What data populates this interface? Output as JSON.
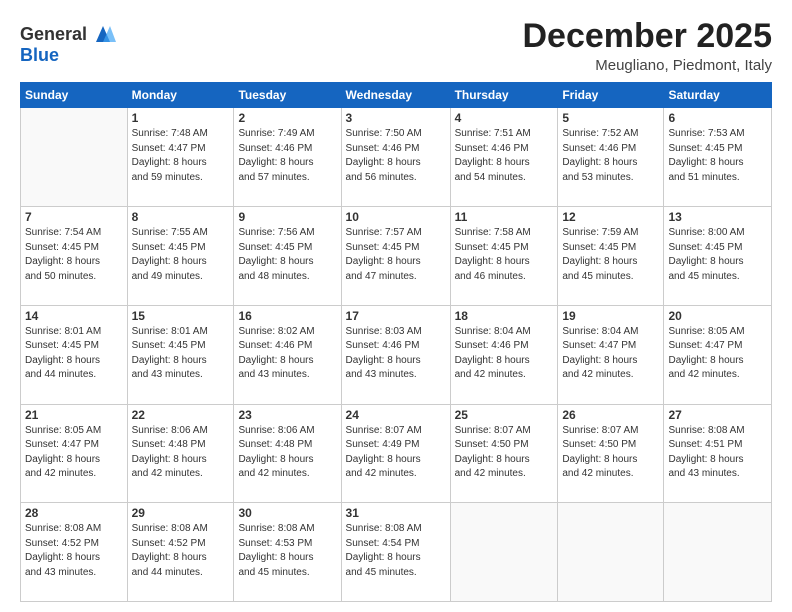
{
  "header": {
    "logo_line1": "General",
    "logo_line2": "Blue",
    "month": "December 2025",
    "location": "Meugliano, Piedmont, Italy"
  },
  "weekdays": [
    "Sunday",
    "Monday",
    "Tuesday",
    "Wednesday",
    "Thursday",
    "Friday",
    "Saturday"
  ],
  "weeks": [
    [
      {
        "day": "",
        "content": ""
      },
      {
        "day": "1",
        "content": "Sunrise: 7:48 AM\nSunset: 4:47 PM\nDaylight: 8 hours\nand 59 minutes."
      },
      {
        "day": "2",
        "content": "Sunrise: 7:49 AM\nSunset: 4:46 PM\nDaylight: 8 hours\nand 57 minutes."
      },
      {
        "day": "3",
        "content": "Sunrise: 7:50 AM\nSunset: 4:46 PM\nDaylight: 8 hours\nand 56 minutes."
      },
      {
        "day": "4",
        "content": "Sunrise: 7:51 AM\nSunset: 4:46 PM\nDaylight: 8 hours\nand 54 minutes."
      },
      {
        "day": "5",
        "content": "Sunrise: 7:52 AM\nSunset: 4:46 PM\nDaylight: 8 hours\nand 53 minutes."
      },
      {
        "day": "6",
        "content": "Sunrise: 7:53 AM\nSunset: 4:45 PM\nDaylight: 8 hours\nand 51 minutes."
      }
    ],
    [
      {
        "day": "7",
        "content": "Sunrise: 7:54 AM\nSunset: 4:45 PM\nDaylight: 8 hours\nand 50 minutes."
      },
      {
        "day": "8",
        "content": "Sunrise: 7:55 AM\nSunset: 4:45 PM\nDaylight: 8 hours\nand 49 minutes."
      },
      {
        "day": "9",
        "content": "Sunrise: 7:56 AM\nSunset: 4:45 PM\nDaylight: 8 hours\nand 48 minutes."
      },
      {
        "day": "10",
        "content": "Sunrise: 7:57 AM\nSunset: 4:45 PM\nDaylight: 8 hours\nand 47 minutes."
      },
      {
        "day": "11",
        "content": "Sunrise: 7:58 AM\nSunset: 4:45 PM\nDaylight: 8 hours\nand 46 minutes."
      },
      {
        "day": "12",
        "content": "Sunrise: 7:59 AM\nSunset: 4:45 PM\nDaylight: 8 hours\nand 45 minutes."
      },
      {
        "day": "13",
        "content": "Sunrise: 8:00 AM\nSunset: 4:45 PM\nDaylight: 8 hours\nand 45 minutes."
      }
    ],
    [
      {
        "day": "14",
        "content": "Sunrise: 8:01 AM\nSunset: 4:45 PM\nDaylight: 8 hours\nand 44 minutes."
      },
      {
        "day": "15",
        "content": "Sunrise: 8:01 AM\nSunset: 4:45 PM\nDaylight: 8 hours\nand 43 minutes."
      },
      {
        "day": "16",
        "content": "Sunrise: 8:02 AM\nSunset: 4:46 PM\nDaylight: 8 hours\nand 43 minutes."
      },
      {
        "day": "17",
        "content": "Sunrise: 8:03 AM\nSunset: 4:46 PM\nDaylight: 8 hours\nand 43 minutes."
      },
      {
        "day": "18",
        "content": "Sunrise: 8:04 AM\nSunset: 4:46 PM\nDaylight: 8 hours\nand 42 minutes."
      },
      {
        "day": "19",
        "content": "Sunrise: 8:04 AM\nSunset: 4:47 PM\nDaylight: 8 hours\nand 42 minutes."
      },
      {
        "day": "20",
        "content": "Sunrise: 8:05 AM\nSunset: 4:47 PM\nDaylight: 8 hours\nand 42 minutes."
      }
    ],
    [
      {
        "day": "21",
        "content": "Sunrise: 8:05 AM\nSunset: 4:47 PM\nDaylight: 8 hours\nand 42 minutes."
      },
      {
        "day": "22",
        "content": "Sunrise: 8:06 AM\nSunset: 4:48 PM\nDaylight: 8 hours\nand 42 minutes."
      },
      {
        "day": "23",
        "content": "Sunrise: 8:06 AM\nSunset: 4:48 PM\nDaylight: 8 hours\nand 42 minutes."
      },
      {
        "day": "24",
        "content": "Sunrise: 8:07 AM\nSunset: 4:49 PM\nDaylight: 8 hours\nand 42 minutes."
      },
      {
        "day": "25",
        "content": "Sunrise: 8:07 AM\nSunset: 4:50 PM\nDaylight: 8 hours\nand 42 minutes."
      },
      {
        "day": "26",
        "content": "Sunrise: 8:07 AM\nSunset: 4:50 PM\nDaylight: 8 hours\nand 42 minutes."
      },
      {
        "day": "27",
        "content": "Sunrise: 8:08 AM\nSunset: 4:51 PM\nDaylight: 8 hours\nand 43 minutes."
      }
    ],
    [
      {
        "day": "28",
        "content": "Sunrise: 8:08 AM\nSunset: 4:52 PM\nDaylight: 8 hours\nand 43 minutes."
      },
      {
        "day": "29",
        "content": "Sunrise: 8:08 AM\nSunset: 4:52 PM\nDaylight: 8 hours\nand 44 minutes."
      },
      {
        "day": "30",
        "content": "Sunrise: 8:08 AM\nSunset: 4:53 PM\nDaylight: 8 hours\nand 45 minutes."
      },
      {
        "day": "31",
        "content": "Sunrise: 8:08 AM\nSunset: 4:54 PM\nDaylight: 8 hours\nand 45 minutes."
      },
      {
        "day": "",
        "content": ""
      },
      {
        "day": "",
        "content": ""
      },
      {
        "day": "",
        "content": ""
      }
    ]
  ]
}
